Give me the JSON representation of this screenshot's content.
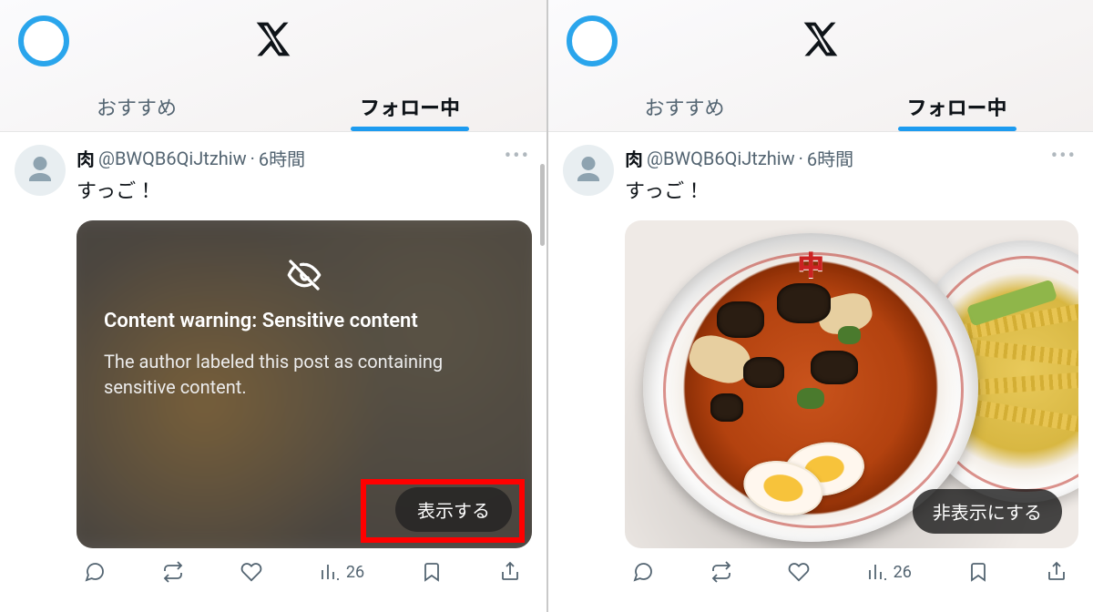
{
  "tabs": {
    "recommend": "おすすめ",
    "following": "フォロー中"
  },
  "post": {
    "name": "肉",
    "handle": "@BWQB6QiJtzhiw",
    "sep": "·",
    "time": "6時間",
    "text": "すっご！"
  },
  "warning": {
    "title": "Content warning: Sensitive content",
    "desc": "The author labeled this post as containing sensitive content.",
    "show_label": "表示する"
  },
  "revealed": {
    "hide_label": "非表示にする",
    "bowl_logo": "中"
  },
  "actions": {
    "views": "26"
  }
}
